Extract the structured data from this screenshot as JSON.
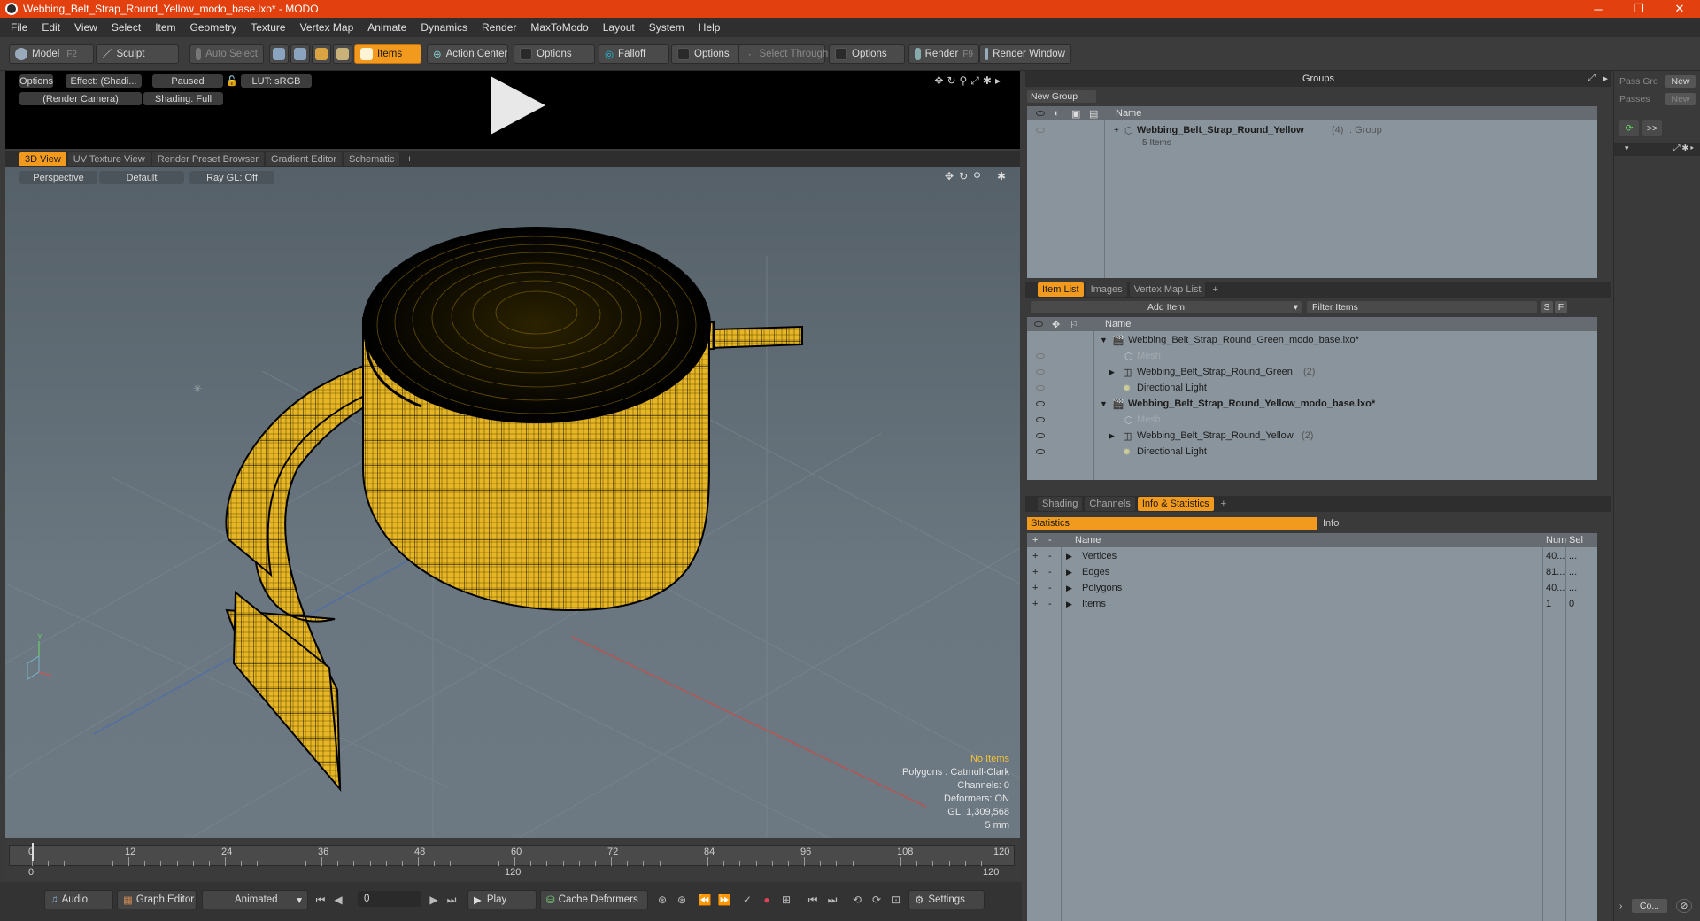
{
  "window": {
    "title": "Webbing_Belt_Strap_Round_Yellow_modo_base.lxo* - MODO",
    "minimize": "─",
    "restore": "❐",
    "close": "✕"
  },
  "menu": [
    "File",
    "Edit",
    "View",
    "Select",
    "Item",
    "Geometry",
    "Texture",
    "Vertex Map",
    "Animate",
    "Dynamics",
    "Render",
    "MaxToModo",
    "Layout",
    "System",
    "Help"
  ],
  "toolbar": {
    "model": "Model",
    "model_key": "F2",
    "sculpt": "Sculpt",
    "auto_select": "Auto Select",
    "items": "Items",
    "action_center": "Action Center",
    "options1": "Options",
    "falloff": "Falloff",
    "options2": "Options",
    "select_through": "Select Through",
    "options3": "Options",
    "render": "Render",
    "render_key": "F9",
    "render_window": "Render Window"
  },
  "preview": {
    "options": "Options",
    "effect": "Effect: (Shadi...",
    "paused": "Paused",
    "lut": "LUT: sRGB",
    "camera": "(Render Camera)",
    "shading": "Shading: Full"
  },
  "viewport_tabs": [
    "3D View",
    "UV Texture View",
    "Render Preset Browser",
    "Gradient Editor",
    "Schematic",
    "+"
  ],
  "viewport": {
    "perspective": "Perspective",
    "default": "Default",
    "raygl": "Ray GL: Off",
    "stats": {
      "no_items": "No Items",
      "polygons": "Polygons : Catmull-Clark",
      "channels": "Channels: 0",
      "deformers": "Deformers: ON",
      "gl": "GL: 1,309,568",
      "unit": "5 mm"
    },
    "colors": {
      "belt": "#e8b92a",
      "wire": "#000000",
      "bg": "#66727b"
    }
  },
  "timeline": {
    "ticks": [
      "0",
      "12",
      "24",
      "36",
      "48",
      "60",
      "72",
      "84",
      "96",
      "108",
      "120"
    ],
    "bottom_left": "0",
    "bottom_mid": "120",
    "bottom_right": "120"
  },
  "bottombar": {
    "audio": "Audio",
    "graph_editor": "Graph Editor",
    "animated": "Animated",
    "frame": "0",
    "play": "Play",
    "cache_deformers": "Cache Deformers",
    "settings": "Settings"
  },
  "groups": {
    "title": "Groups",
    "new_group": "New Group",
    "col_name": "Name",
    "item_name": "Webbing_Belt_Strap_Round_Yellow",
    "item_count": "(4)",
    "item_type": ": Group",
    "item_sub": "5 Items"
  },
  "passes": {
    "pass_group": "Pass Gro",
    "new1": "New",
    "passes": "Passes",
    "new2": "New",
    "more": ">>",
    "co": "Co..."
  },
  "item_list": {
    "tabs": [
      "Item List",
      "Images",
      "Vertex Map List",
      "+"
    ],
    "add_item": "Add Item",
    "filter": "Filter Items",
    "s": "S",
    "f": "F",
    "col_name": "Name",
    "rows": [
      {
        "label": "Webbing_Belt_Strap_Round_Green_modo_base.lxo*",
        "bold": false,
        "count": ""
      },
      {
        "label": "Mesh",
        "bold": false,
        "count": ""
      },
      {
        "label": "Webbing_Belt_Strap_Round_Green",
        "bold": false,
        "count": "(2)"
      },
      {
        "label": "Directional Light",
        "bold": false,
        "count": ""
      },
      {
        "label": "Webbing_Belt_Strap_Round_Yellow_modo_base.lxo*",
        "bold": true,
        "count": ""
      },
      {
        "label": "Mesh",
        "bold": false,
        "count": ""
      },
      {
        "label": "Webbing_Belt_Strap_Round_Yellow",
        "bold": false,
        "count": "(2)"
      },
      {
        "label": "Directional Light",
        "bold": false,
        "count": ""
      }
    ]
  },
  "stats_panel": {
    "tabs": [
      "Shading",
      "Channels",
      "Info & Statistics",
      "+"
    ],
    "statistics": "Statistics",
    "info": "Info",
    "col_name": "Name",
    "col_num": "Num",
    "col_sel": "Sel",
    "rows": [
      {
        "name": "Vertices",
        "num": "40...",
        "sel": "..."
      },
      {
        "name": "Edges",
        "num": "81...",
        "sel": "..."
      },
      {
        "name": "Polygons",
        "num": "40...",
        "sel": "..."
      },
      {
        "name": "Items",
        "num": "1",
        "sel": "0"
      }
    ]
  }
}
